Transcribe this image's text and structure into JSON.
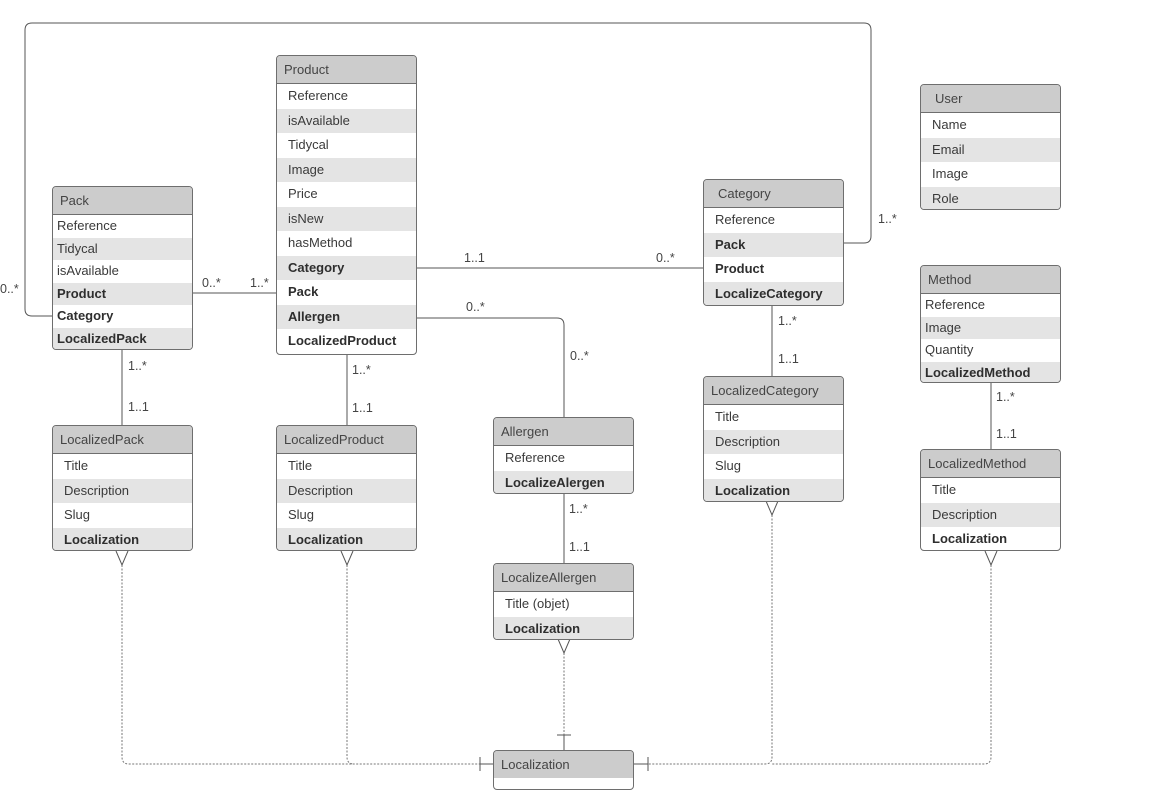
{
  "diagram": {
    "type": "entity-relationship",
    "entities": {
      "product": {
        "title": "Product",
        "fields": [
          {
            "name": "Reference",
            "relation": false
          },
          {
            "name": "isAvailable",
            "relation": false
          },
          {
            "name": "Tidycal",
            "relation": false
          },
          {
            "name": "Image",
            "relation": false
          },
          {
            "name": "Price",
            "relation": false
          },
          {
            "name": "isNew",
            "relation": false
          },
          {
            "name": "hasMethod",
            "relation": false
          },
          {
            "name": "Category",
            "relation": true
          },
          {
            "name": "Pack",
            "relation": true
          },
          {
            "name": "Allergen",
            "relation": true
          },
          {
            "name": "LocalizedProduct",
            "relation": true
          }
        ]
      },
      "pack": {
        "title": "Pack",
        "fields": [
          {
            "name": "Reference",
            "relation": false
          },
          {
            "name": "Tidycal",
            "relation": false
          },
          {
            "name": "isAvailable",
            "relation": false
          },
          {
            "name": "Product",
            "relation": true
          },
          {
            "name": "Category",
            "relation": true
          },
          {
            "name": "LocalizedPack",
            "relation": true
          }
        ]
      },
      "category": {
        "title": "Category",
        "fields": [
          {
            "name": "Reference",
            "relation": false
          },
          {
            "name": "Pack",
            "relation": true
          },
          {
            "name": "Product",
            "relation": true
          },
          {
            "name": "LocalizeCategory",
            "relation": true
          }
        ]
      },
      "user": {
        "title": "User",
        "fields": [
          {
            "name": "Name",
            "relation": false
          },
          {
            "name": "Email",
            "relation": false
          },
          {
            "name": "Image",
            "relation": false
          },
          {
            "name": "Role",
            "relation": false
          }
        ]
      },
      "method": {
        "title": "Method",
        "fields": [
          {
            "name": "Reference",
            "relation": false
          },
          {
            "name": "Image",
            "relation": false
          },
          {
            "name": "Quantity",
            "relation": false
          },
          {
            "name": "LocalizedMethod",
            "relation": true
          }
        ]
      },
      "localized_pack": {
        "title": "LocalizedPack",
        "fields": [
          {
            "name": "Title",
            "relation": false
          },
          {
            "name": "Description",
            "relation": false
          },
          {
            "name": "Slug",
            "relation": false
          },
          {
            "name": "Localization",
            "relation": true
          }
        ]
      },
      "localized_product": {
        "title": "LocalizedProduct",
        "fields": [
          {
            "name": "Title",
            "relation": false
          },
          {
            "name": "Description",
            "relation": false
          },
          {
            "name": "Slug",
            "relation": false
          },
          {
            "name": "Localization",
            "relation": true
          }
        ]
      },
      "allergen": {
        "title": "Allergen",
        "fields": [
          {
            "name": "Reference",
            "relation": false
          },
          {
            "name": "LocalizeAlergen",
            "relation": true
          }
        ]
      },
      "localize_allergen": {
        "title": "LocalizeAllergen",
        "fields": [
          {
            "name": "Title (objet)",
            "relation": false
          },
          {
            "name": "Localization",
            "relation": true
          }
        ]
      },
      "localized_category": {
        "title": "LocalizedCategory",
        "fields": [
          {
            "name": "Title",
            "relation": false
          },
          {
            "name": "Description",
            "relation": false
          },
          {
            "name": "Slug",
            "relation": false
          },
          {
            "name": "Localization",
            "relation": true
          }
        ]
      },
      "localized_method": {
        "title": "LocalizedMethod",
        "fields": [
          {
            "name": "Title",
            "relation": false
          },
          {
            "name": "Description",
            "relation": false
          },
          {
            "name": "Localization",
            "relation": true
          }
        ]
      },
      "localization": {
        "title": "Localization",
        "fields": []
      }
    },
    "relationships": [
      {
        "from": "Pack",
        "to": "Product",
        "from_card": "0..*",
        "to_card": "1..*"
      },
      {
        "from": "Product",
        "to": "Category",
        "from_card": "1..1",
        "to_card": "0..*"
      },
      {
        "from": "Product",
        "to": "Allergen",
        "from_card": "0..*",
        "to_card": "0..*"
      },
      {
        "from": "Pack",
        "to": "Category",
        "from_card": "0..*",
        "to_card": "1..*"
      },
      {
        "from": "Pack",
        "to": "LocalizedPack",
        "from_card": "1..*",
        "to_card": "1..1"
      },
      {
        "from": "Product",
        "to": "LocalizedProduct",
        "from_card": "1..*",
        "to_card": "1..1"
      },
      {
        "from": "Category",
        "to": "LocalizedCategory",
        "from_card": "1..*",
        "to_card": "1..1"
      },
      {
        "from": "Allergen",
        "to": "LocalizeAllergen",
        "from_card": "1..*",
        "to_card": "1..1"
      },
      {
        "from": "Method",
        "to": "LocalizedMethod",
        "from_card": "1..*",
        "to_card": "1..1"
      },
      {
        "from": "LocalizedPack",
        "to": "Localization",
        "style": "dashed",
        "notation": "many-to-one"
      },
      {
        "from": "LocalizedProduct",
        "to": "Localization",
        "style": "dashed",
        "notation": "many-to-one"
      },
      {
        "from": "LocalizeAllergen",
        "to": "Localization",
        "style": "dashed",
        "notation": "many-to-one"
      },
      {
        "from": "LocalizedCategory",
        "to": "Localization",
        "style": "dashed",
        "notation": "many-to-one"
      },
      {
        "from": "LocalizedMethod",
        "to": "Localization",
        "style": "dashed",
        "notation": "many-to-one"
      }
    ],
    "labels": {
      "pack_category_left": "0..*",
      "pack_category_right": "1..*",
      "pack_product_left": "0..*",
      "pack_product_right": "1..*",
      "product_category_left": "1..1",
      "product_category_right": "0..*",
      "product_allergen_top": "0..*",
      "product_allergen_bottom": "0..*",
      "pack_lp_top": "1..*",
      "pack_lp_bottom": "1..1",
      "product_lp_top": "1..*",
      "product_lp_bottom": "1..1",
      "category_lc_top": "1..*",
      "category_lc_bottom": "1..1",
      "allergen_la_top": "1..*",
      "allergen_la_bottom": "1..1",
      "method_lm_top": "1..*",
      "method_lm_bottom": "1..1"
    },
    "colors": {
      "header_fill": "#cccccc",
      "alt_row_fill": "#e4e4e4",
      "border": "#6e6e6e",
      "line": "#555555",
      "dashed_line": "#777777"
    }
  }
}
